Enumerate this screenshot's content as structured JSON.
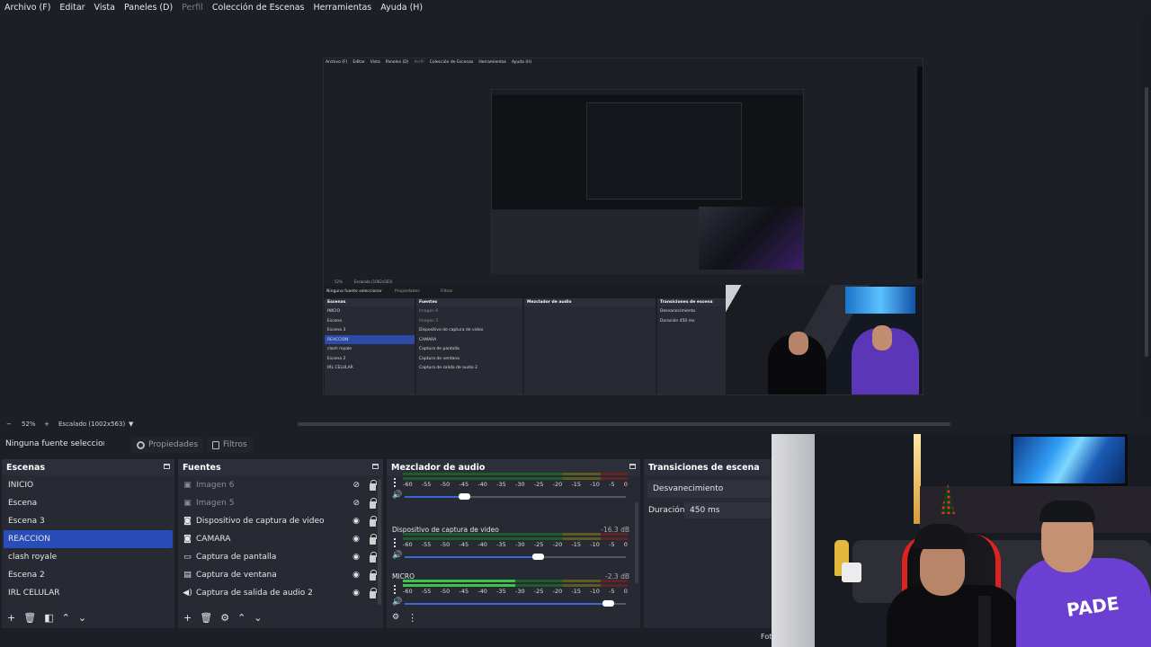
{
  "menu": [
    "Archivo (F)",
    "Editar",
    "Vista",
    "Paneles (D)",
    "Perfil",
    "Colección de Escenas",
    "Herramientas",
    "Ayuda (H)"
  ],
  "controls": {
    "zoom": "52%",
    "scaling": "Escalado (1002x563)",
    "minus": "−",
    "plus": "+",
    "caret": "▼"
  },
  "properties_bar": {
    "no_selection": "Ninguna fuente selecciona",
    "properties_label": "Propiedades",
    "filters_label": "Filtros"
  },
  "scenes": {
    "title": "Escenas",
    "items": [
      "INICIO",
      "Escena",
      "Escena 3",
      "REACCION",
      "clash royale",
      "Escena 2",
      "IRL CELULAR"
    ],
    "selected_index": 3
  },
  "sources": {
    "title": "Fuentes",
    "items": [
      {
        "label": "Imagen 6",
        "icon": "image-icon",
        "visible": false
      },
      {
        "label": "Imagen 5",
        "icon": "image-icon",
        "visible": false
      },
      {
        "label": "Dispositivo de captura de video",
        "icon": "camera-icon",
        "visible": true
      },
      {
        "label": "CAMARA",
        "icon": "camera-icon",
        "visible": true
      },
      {
        "label": "Captura de pantalla",
        "icon": "monitor-icon",
        "visible": true
      },
      {
        "label": "Captura de ventana",
        "icon": "window-icon",
        "visible": true
      },
      {
        "label": "Captura de salida de audio 2",
        "icon": "speaker-icon",
        "visible": true
      }
    ]
  },
  "mixer": {
    "title": "Mezclador de audio",
    "ticks": [
      "-60",
      "-55",
      "-50",
      "-45",
      "-40",
      "-35",
      "-30",
      "-25",
      "-20",
      "-15",
      "-10",
      "-5",
      "0"
    ],
    "channels": [
      {
        "name": "",
        "db": "",
        "volume": 0.27
      },
      {
        "name": "Dispositivo de captura de video",
        "db": "-16.3 dB",
        "volume": 0.6
      },
      {
        "name": "MICRO",
        "db": "-2.3 dB",
        "volume": 0.92
      }
    ]
  },
  "transitions": {
    "title": "Transiciones de escena",
    "selected": "Desvanecimiento",
    "duration_label": "Duración",
    "duration_value": "450 ms"
  },
  "nested": {
    "menu": [
      "Archivo (F)",
      "Editar",
      "Vista",
      "Paneles (D)",
      "Perfil",
      "Colección de Escenas",
      "Herramientas",
      "Ayuda (H)"
    ],
    "zoom": "52%",
    "scaling": "Escalado (1002x563)",
    "no_selection": "Ninguna fuente seleccionar",
    "properties_label": "Propiedades",
    "filters_label": "Filtros",
    "scenes_title": "Escenas",
    "sources_title": "Fuentes",
    "mixer_title": "Mezclador de audio",
    "transitions_title": "Transiciones de escena",
    "transition_selected": "Desvanecimiento",
    "duration_label": "Duración",
    "duration_value": "450 ms"
  },
  "webcam": {
    "shirt_text": "PADE",
    "footer_text": "Fot"
  }
}
